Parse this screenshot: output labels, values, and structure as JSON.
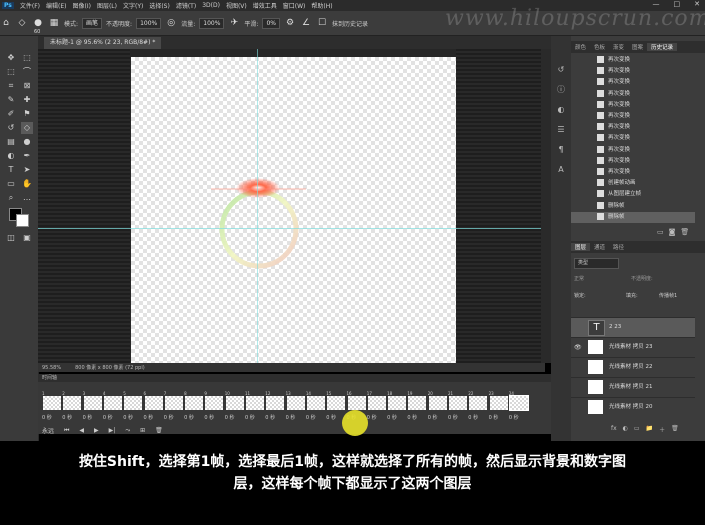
{
  "menu": {
    "logo": "Ps",
    "items": [
      "文件(F)",
      "编辑(E)",
      "图像(I)",
      "图层(L)",
      "文字(Y)",
      "选择(S)",
      "滤镜(T)",
      "3D(D)",
      "视图(V)",
      "增效工具",
      "窗口(W)",
      "帮助(H)"
    ],
    "win_controls": [
      "—",
      "□",
      "✕"
    ]
  },
  "options": {
    "brush_size": "60",
    "mode_label": "模式:",
    "mode_value": "画笔",
    "opacity_label": "不透明度:",
    "opacity_value": "100%",
    "flow_label": "流量:",
    "flow_value": "100%",
    "smooth_label": "平滑:",
    "smooth_value": "0%",
    "history_label": "抹到历史记录"
  },
  "watermark": "www.hiloupscrun.com",
  "document": {
    "tab_title": "未标题-1 @ 95.6% (2 23, RGB/8#) *",
    "zoom": "95.58%",
    "size_info": "800 像素 x 800 像素 (72 ppi)"
  },
  "timeline": {
    "title": "时间轴",
    "frames": [
      {
        "num": "1",
        "dur": "0 秒"
      },
      {
        "num": "2",
        "dur": "0 秒"
      },
      {
        "num": "3",
        "dur": "0 秒"
      },
      {
        "num": "4",
        "dur": "0 秒"
      },
      {
        "num": "5",
        "dur": "0 秒"
      },
      {
        "num": "6",
        "dur": "0 秒"
      },
      {
        "num": "7",
        "dur": "0 秒"
      },
      {
        "num": "8",
        "dur": "0 秒"
      },
      {
        "num": "9",
        "dur": "0 秒"
      },
      {
        "num": "10",
        "dur": "0 秒"
      },
      {
        "num": "11",
        "dur": "0 秒"
      },
      {
        "num": "12",
        "dur": "0 秒"
      },
      {
        "num": "13",
        "dur": "0 秒"
      },
      {
        "num": "14",
        "dur": "0 秒"
      },
      {
        "num": "15",
        "dur": "0 秒"
      },
      {
        "num": "16",
        "dur": "0 秒"
      },
      {
        "num": "17",
        "dur": "0 秒"
      },
      {
        "num": "18",
        "dur": "0 秒"
      },
      {
        "num": "19",
        "dur": "0 秒"
      },
      {
        "num": "20",
        "dur": "0 秒"
      },
      {
        "num": "21",
        "dur": "0 秒"
      },
      {
        "num": "22",
        "dur": "0 秒"
      },
      {
        "num": "23",
        "dur": "0 秒"
      },
      {
        "num": "24",
        "dur": "0 秒"
      }
    ],
    "loop_label": "永远",
    "controls": [
      "⏮",
      "◀",
      "▶",
      "▶|",
      "⤳",
      "⊞",
      "🗑"
    ]
  },
  "history": {
    "tabs": [
      "颜色",
      "色板",
      "渐变",
      "图案",
      "历史记录"
    ],
    "items": [
      "再次变换",
      "再次变换",
      "再次变换",
      "再次变换",
      "再次变换",
      "再次变换",
      "再次变换",
      "再次变换",
      "再次变换",
      "再次变换",
      "再次变换",
      "创建帧动画",
      "从图层建立帧",
      "删除帧",
      "删除帧"
    ]
  },
  "layers": {
    "tabs": [
      "图层",
      "通道",
      "路径"
    ],
    "kind_label": "类型",
    "blend_mode": "正常",
    "opacity_label": "不透明度:",
    "lock_label": "锁定:",
    "fill_label": "填充:",
    "propagate_label": "传播帧1",
    "items": [
      {
        "name": "2 23",
        "type": "text",
        "visible": false,
        "selected": true
      },
      {
        "name": "光线素材 拷贝 23",
        "type": "image",
        "visible": true,
        "selected": false
      },
      {
        "name": "光线素材 拷贝 22",
        "type": "image",
        "visible": false,
        "selected": false
      },
      {
        "name": "光线素材 拷贝 21",
        "type": "image",
        "visible": false,
        "selected": false
      },
      {
        "name": "光线素材 拷贝 20",
        "type": "image",
        "visible": false,
        "selected": false
      }
    ],
    "footer_icons": [
      "fx",
      "◐",
      "▭",
      "📁",
      "＋",
      "🗑"
    ]
  },
  "subtitle": {
    "line1": "按住Shift，选择第1帧，选择最后1帧，这样就选择了所有的帧，然后显示背景和数字图",
    "line2": "层，这样每个帧下都显示了这两个图层"
  },
  "colors": {
    "panel_bg": "#3c3c3c",
    "accent_cursor": "#e8e22a",
    "guide": "#7fdede"
  }
}
